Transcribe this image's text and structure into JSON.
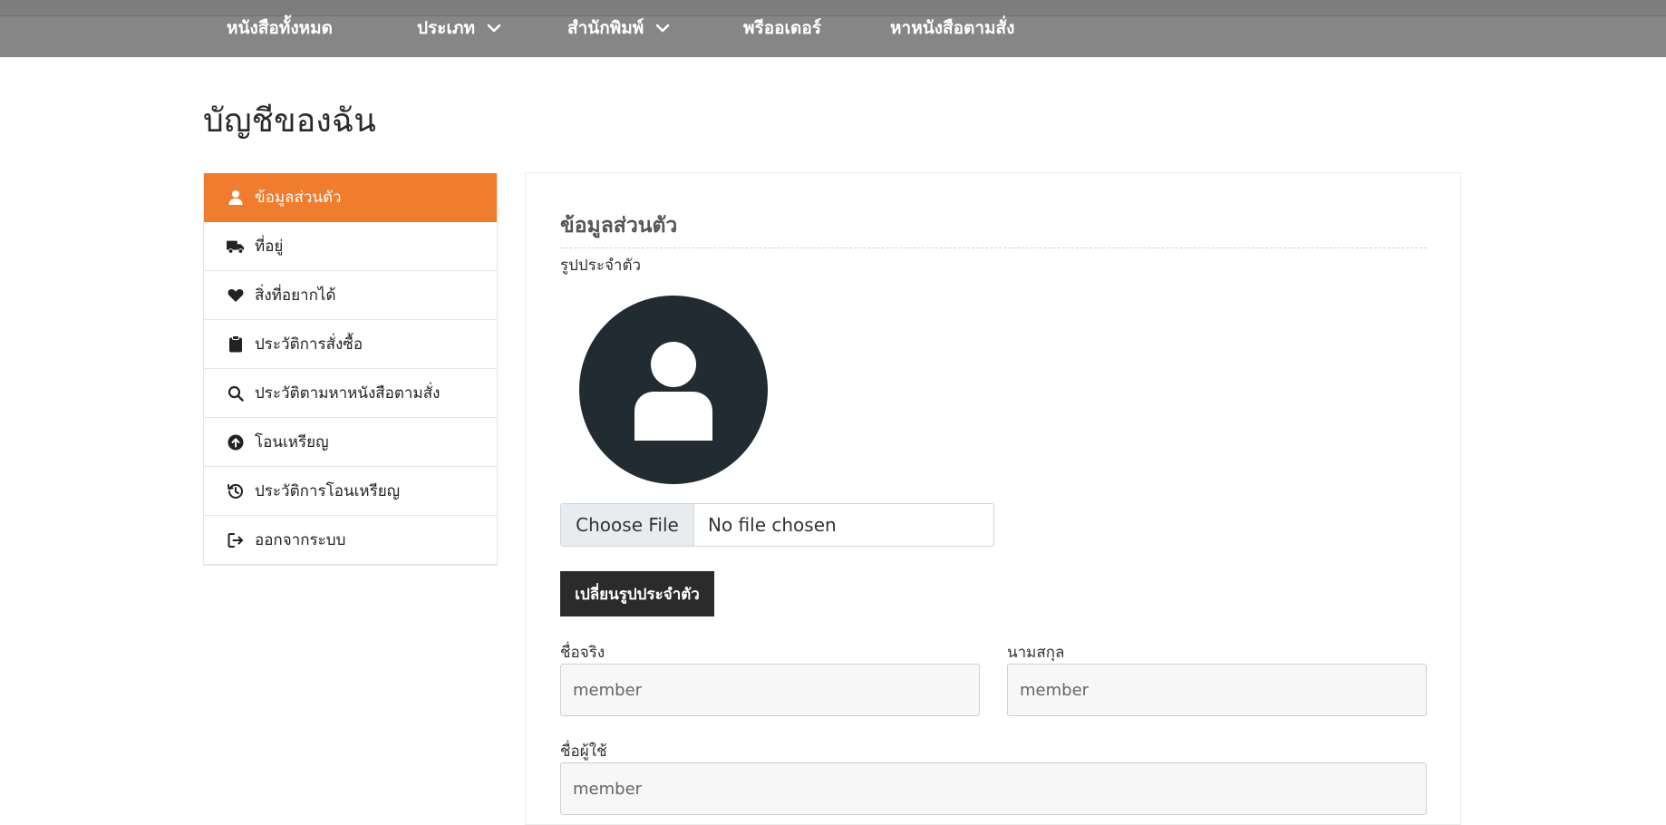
{
  "nav": {
    "items": [
      {
        "label": "หนังสือทั้งหมด",
        "has_dropdown": false
      },
      {
        "label": "ประเภท",
        "has_dropdown": true
      },
      {
        "label": "สำนักพิมพ์",
        "has_dropdown": true
      },
      {
        "label": "พรีออเดอร์",
        "has_dropdown": false
      },
      {
        "label": "หาหนังสือตามสั่ง",
        "has_dropdown": false
      }
    ]
  },
  "page": {
    "title": "บัญชีของฉัน"
  },
  "sidebar": {
    "active_color": "#f07d2d",
    "items": [
      {
        "label": "ข้อมูลส่วนตัว",
        "icon": "user-icon",
        "active": true
      },
      {
        "label": "ที่อยู่",
        "icon": "truck-icon",
        "active": false
      },
      {
        "label": "สิ่งที่อยากได้",
        "icon": "heart-icon",
        "active": false
      },
      {
        "label": "ประวัติการสั่งซื้อ",
        "icon": "clipboard-icon",
        "active": false
      },
      {
        "label": "ประวัติตามหาหนังสือตามสั่ง",
        "icon": "search-icon",
        "active": false
      },
      {
        "label": "โอนเหรียญ",
        "icon": "upload-circle-icon",
        "active": false
      },
      {
        "label": "ประวัติการโอนเหรียญ",
        "icon": "history-icon",
        "active": false
      },
      {
        "label": "ออกจากระบบ",
        "icon": "logout-icon",
        "active": false
      }
    ]
  },
  "profile": {
    "section_title": "ข้อมูลส่วนตัว",
    "avatar_label": "รูปประจำตัว",
    "file_button": "Choose File",
    "file_status": "No file chosen",
    "change_button": "เปลี่ยนรูปประจำตัว",
    "first_name_label": "ชื่อจริง",
    "first_name_value": "member",
    "last_name_label": "นามสกุล",
    "last_name_value": "member",
    "username_label": "ชื่อผู้ใช้",
    "username_value": "member"
  }
}
